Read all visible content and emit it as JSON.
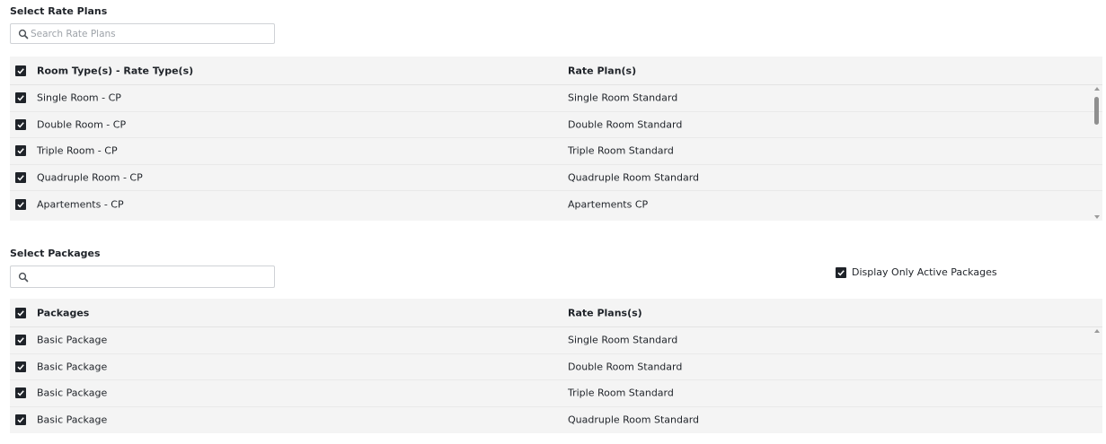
{
  "rate_plans": {
    "title": "Select Rate Plans",
    "search": {
      "placeholder": "Search Rate Plans",
      "value": ""
    },
    "columns": [
      "Room Type(s) - Rate Type(s)",
      "Rate Plan(s)"
    ],
    "header_checked": true,
    "rows": [
      {
        "room_rate": "Single Room - CP",
        "plan": "Single Room Standard",
        "checked": true
      },
      {
        "room_rate": "Double Room - CP",
        "plan": "Double Room Standard",
        "checked": true
      },
      {
        "room_rate": "Triple Room - CP",
        "plan": "Triple Room Standard",
        "checked": true
      },
      {
        "room_rate": "Quadruple Room - CP",
        "plan": "Quadruple Room Standard",
        "checked": true
      },
      {
        "room_rate": "Apartements - CP",
        "plan": "Apartements CP",
        "checked": true
      }
    ]
  },
  "packages": {
    "title": "Select Packages",
    "search": {
      "placeholder": "",
      "value": ""
    },
    "active_only": {
      "label": "Display Only Active Packages",
      "checked": true
    },
    "columns": [
      "Packages",
      "Rate Plans(s)"
    ],
    "header_checked": true,
    "rows": [
      {
        "package": "Basic Package",
        "plan": "Single Room Standard",
        "checked": true
      },
      {
        "package": "Basic Package",
        "plan": "Double Room Standard",
        "checked": true
      },
      {
        "package": "Basic Package",
        "plan": "Triple Room Standard",
        "checked": true
      },
      {
        "package": "Basic Package",
        "plan": "Quadruple Room Standard",
        "checked": true
      }
    ]
  },
  "icons": {
    "search": "search-icon",
    "checkbox": "checkmark-icon"
  },
  "colors": {
    "checkbox_fill": "#1f2329",
    "grid_bg": "#f4f4f4",
    "border": "#cfd2d6"
  }
}
